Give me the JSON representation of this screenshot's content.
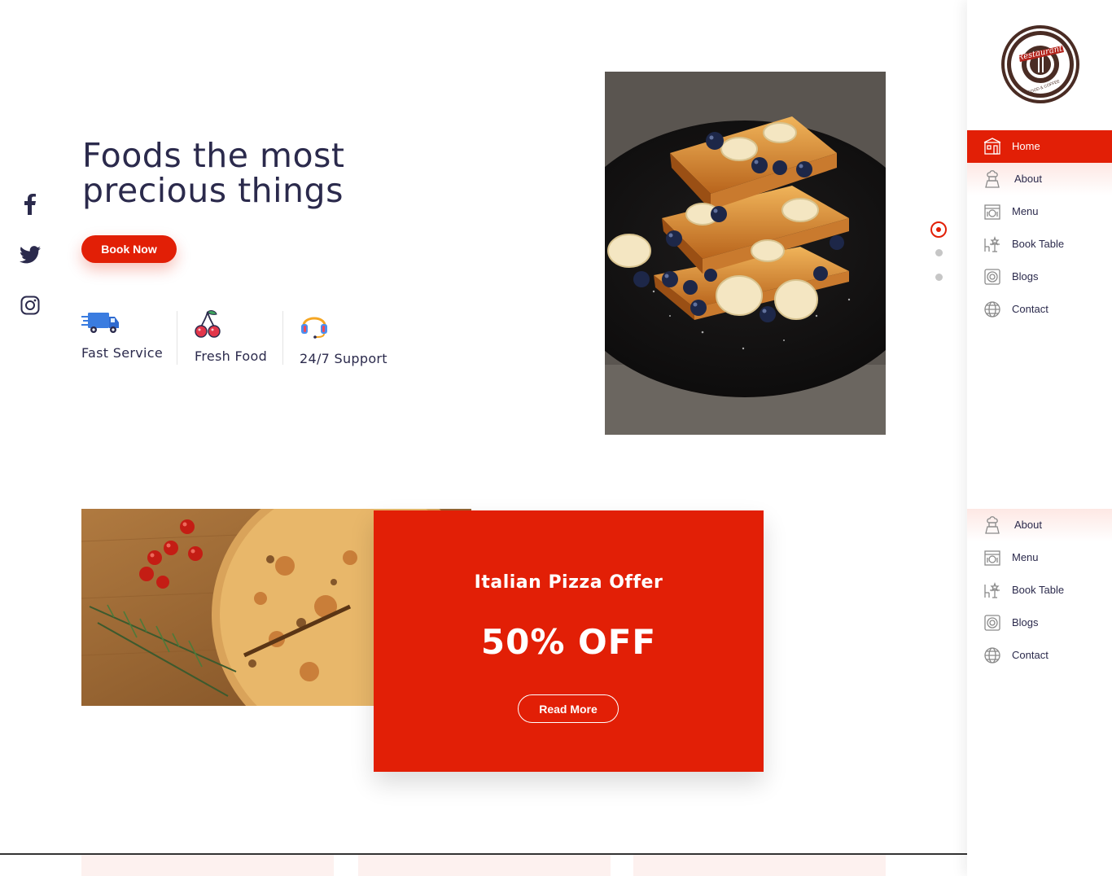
{
  "hero": {
    "title_line1": "Foods the most",
    "title_line2": "precious things",
    "book_button": "Book Now"
  },
  "social": [
    {
      "name": "facebook-icon"
    },
    {
      "name": "twitter-icon"
    },
    {
      "name": "instagram-icon"
    }
  ],
  "features": [
    {
      "label": "Fast Service",
      "icon": "delivery-truck-icon"
    },
    {
      "label": "Fresh Food",
      "icon": "cherry-icon"
    },
    {
      "label": "24/7 Support",
      "icon": "headset-icon"
    }
  ],
  "slider": {
    "active_index": 0,
    "count": 3
  },
  "offer": {
    "title": "Italian Pizza Offer",
    "headline": "50% OFF",
    "button": "Read More"
  },
  "sidebar": {
    "logo_text_top": "Restaurant",
    "logo_text_bottom": "FOOD & COFFEE",
    "nav": [
      {
        "label": "Home",
        "icon": "home-icon",
        "active": true
      },
      {
        "label": "About",
        "icon": "chef-icon"
      },
      {
        "label": "Menu",
        "icon": "menu-icon"
      },
      {
        "label": "Book Table",
        "icon": "table-icon"
      },
      {
        "label": "Blogs",
        "icon": "blog-icon"
      },
      {
        "label": "Contact",
        "icon": "globe-icon"
      }
    ],
    "nav_repeat": [
      {
        "label": "About",
        "icon": "chef-icon"
      },
      {
        "label": "Menu",
        "icon": "menu-icon"
      },
      {
        "label": "Book Table",
        "icon": "table-icon"
      },
      {
        "label": "Blogs",
        "icon": "blog-icon"
      },
      {
        "label": "Contact",
        "icon": "globe-icon"
      }
    ]
  },
  "colors": {
    "accent": "#e21f06",
    "text_dark": "#2b2a4c",
    "dot_inactive": "#c6c6c6"
  }
}
